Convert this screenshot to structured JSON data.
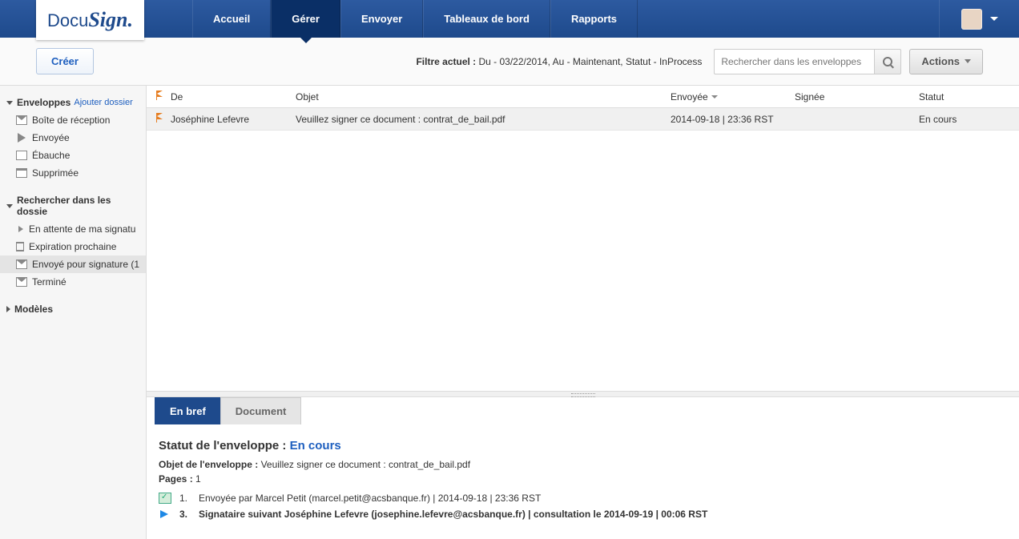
{
  "logo": {
    "part1": "Docu",
    "part2": "Sign."
  },
  "nav": {
    "items": [
      {
        "label": "Accueil",
        "active": false
      },
      {
        "label": "Gérer",
        "active": true
      },
      {
        "label": "Envoyer",
        "active": false
      },
      {
        "label": "Tableaux de bord",
        "active": false
      },
      {
        "label": "Rapports",
        "active": false
      }
    ]
  },
  "actionbar": {
    "create": "Créer",
    "filter_label": "Filtre actuel :",
    "filter_value": "Du - 03/22/2014, Au - Maintenant, Statut - InProcess",
    "search_placeholder": "Rechercher dans les enveloppes",
    "actions": "Actions"
  },
  "sidebar": {
    "envelopes": {
      "header": "Enveloppes",
      "add_link": "Ajouter dossier",
      "items": [
        "Boîte de réception",
        "Envoyée",
        "Ébauche",
        "Supprimée"
      ]
    },
    "search": {
      "header": "Rechercher dans les dossie",
      "items": [
        "En attente de ma signatu",
        "Expiration prochaine",
        "Envoyé pour signature (1",
        "Terminé"
      ],
      "active_index": 2
    },
    "models": {
      "header": "Modèles"
    }
  },
  "table": {
    "headers": {
      "from": "De",
      "object": "Objet",
      "sent": "Envoyée",
      "signed": "Signée",
      "status": "Statut"
    },
    "rows": [
      {
        "from": "Joséphine Lefevre",
        "object": "Veuillez signer ce document : contrat_de_bail.pdf",
        "sent": "2014-09-18 | 23:36 RST",
        "signed": "",
        "status": "En cours"
      }
    ]
  },
  "detail": {
    "tabs": {
      "brief": "En bref",
      "document": "Document"
    },
    "status_label": "Statut de l'enveloppe :",
    "status_value": "En cours",
    "object_label": "Objet de l'enveloppe :",
    "object_value": "Veuillez signer ce document : contrat_de_bail.pdf",
    "pages_label": "Pages :",
    "pages_value": "1",
    "history": [
      {
        "num": "1.",
        "text": "Envoyée par Marcel Petit (marcel.petit@acsbanque.fr) | 2014-09-18 | 23:36 RST",
        "bold": false,
        "icon": "sent"
      },
      {
        "num": "3.",
        "text": "Signataire suivant Joséphine Lefevre (josephine.lefevre@acsbanque.fr) | consultation le 2014-09-19 | 00:06 RST",
        "bold": true,
        "icon": "arrow"
      }
    ]
  }
}
